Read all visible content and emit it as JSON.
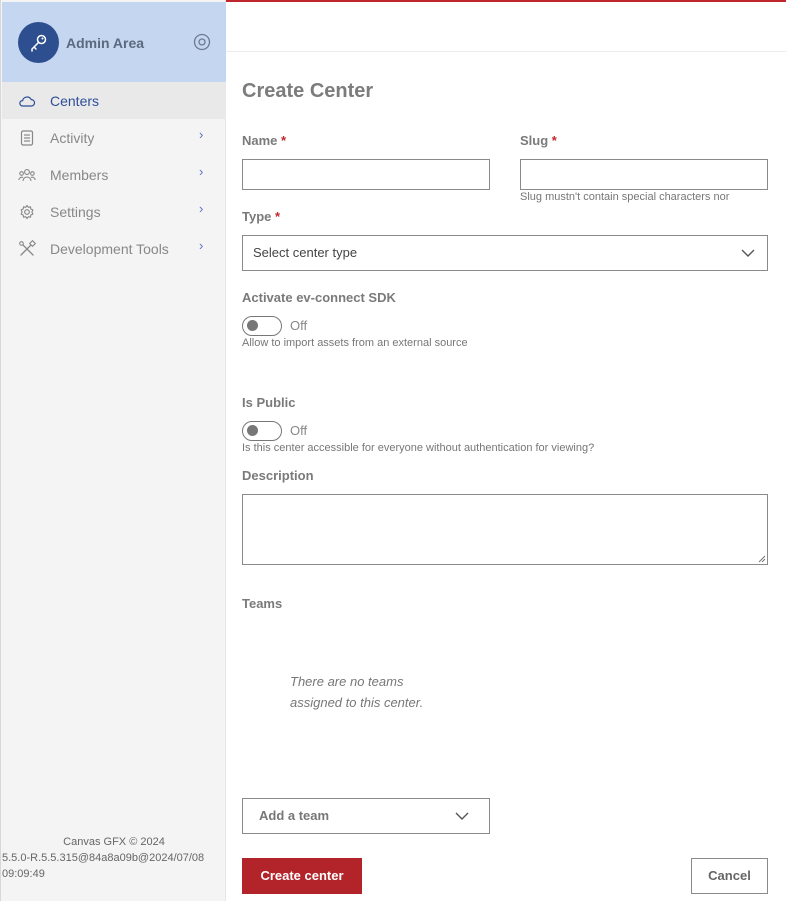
{
  "sidebar": {
    "title": "Admin Area",
    "header_icon": "key-icon",
    "settings_icon": "target-circle-icon",
    "items": [
      {
        "label": "Centers",
        "icon": "cloud-icon",
        "active": true
      },
      {
        "label": "Activity",
        "icon": "log-icon",
        "has_submenu": true
      },
      {
        "label": "Members",
        "icon": "users-icon",
        "has_submenu": true
      },
      {
        "label": "Settings",
        "icon": "gear-icon",
        "has_submenu": true
      },
      {
        "label": "Development Tools",
        "icon": "tools-icon",
        "has_submenu": true
      }
    ],
    "chevron": "›",
    "footer_line1": "Canvas GFX © 2024",
    "footer_line2": "5.5.0-R.5.5.315@84a8a09b@2024/07/08",
    "footer_line3": "09:09:49"
  },
  "form": {
    "title": "Create Center",
    "required_mark": "*",
    "name_label": "Name",
    "name_value": "",
    "slug_label": "Slug",
    "slug_value": "",
    "slug_hint": "Slug mustn't contain special characters nor",
    "type_label": "Type",
    "type_placeholder": "Select center type",
    "sdk_label": "Activate ev-connect SDK",
    "sdk_state": "Off",
    "sdk_hint": "Allow to import assets from an external source",
    "public_label": "Is Public",
    "public_state": "Off",
    "public_hint": "Is this center accessible for everyone without authentication for viewing?",
    "description_label": "Description",
    "description_value": "",
    "teams_label": "Teams",
    "teams_empty_line1": "There are no teams",
    "teams_empty_line2": "assigned to this center.",
    "add_team_placeholder": "Add a team",
    "create_button": "Create center",
    "cancel_button": "Cancel"
  },
  "colors": {
    "accent_red": "#c0272d",
    "sidebar_header": "#c5d7f0",
    "avatar": "#2d4f8f",
    "active_nav_text": "#2f4e97"
  }
}
